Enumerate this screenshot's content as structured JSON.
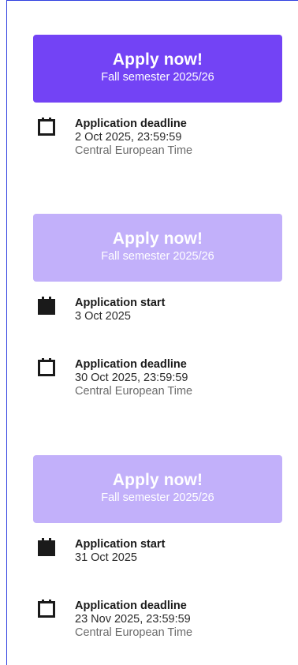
{
  "sessions": [
    {
      "button": {
        "title": "Apply now!",
        "subtitle": "Fall semester 2025/26"
      },
      "deadline": {
        "label": "Application deadline",
        "date": "2 Oct 2025, 23:59:59",
        "timezone": "Central European Time"
      }
    },
    {
      "button": {
        "title": "Apply now!",
        "subtitle": "Fall semester 2025/26"
      },
      "start": {
        "label": "Application start",
        "date": "3 Oct 2025"
      },
      "deadline": {
        "label": "Application deadline",
        "date": "30 Oct 2025, 23:59:59",
        "timezone": "Central European Time"
      }
    },
    {
      "button": {
        "title": "Apply now!",
        "subtitle": "Fall semester 2025/26"
      },
      "start": {
        "label": "Application start",
        "date": "31 Oct 2025"
      },
      "deadline": {
        "label": "Application deadline",
        "date": "23 Nov 2025, 23:59:59",
        "timezone": "Central European Time"
      }
    }
  ],
  "icons": {
    "start": "calendar-filled-icon",
    "deadline": "calendar-outline-icon"
  },
  "colors": {
    "button_active": "#7343f5",
    "button_disabled": "#c2b0fa",
    "frame": "#2f3fe0"
  }
}
